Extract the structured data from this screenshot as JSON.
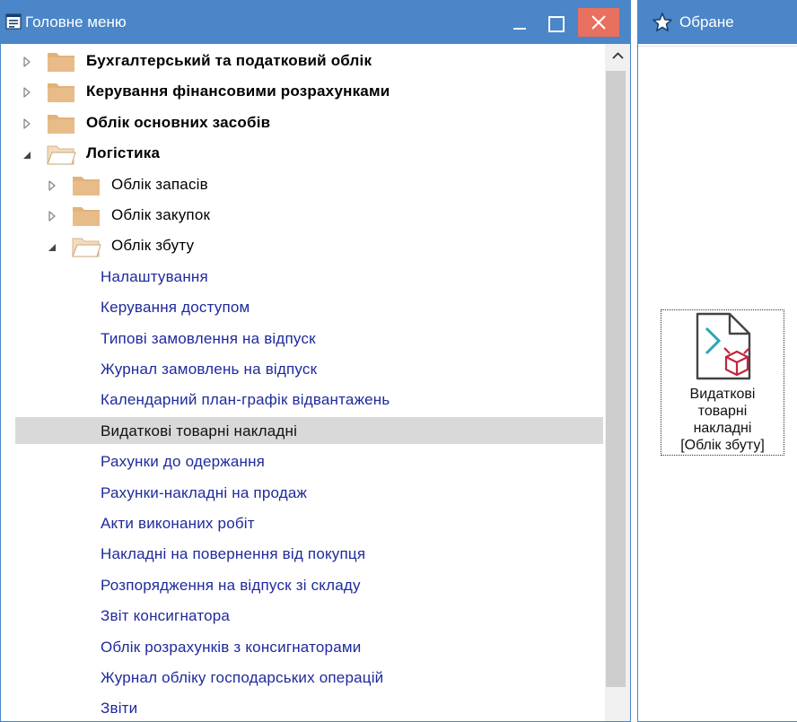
{
  "main_window": {
    "title": "Головне меню",
    "buttons": {
      "minimize": "minimize",
      "maximize": "maximize",
      "close": "close"
    }
  },
  "tree": [
    {
      "label": "Бухгалтерський та податковий облік",
      "level": 0,
      "expanded": false
    },
    {
      "label": "Керування фінансовими розрахунками",
      "level": 0,
      "expanded": false
    },
    {
      "label": "Облік основних засобів",
      "level": 0,
      "expanded": false
    },
    {
      "label": "Логістика",
      "level": 0,
      "expanded": true
    },
    {
      "label": "Облік запасів",
      "level": 1,
      "expanded": false
    },
    {
      "label": "Облік закупок",
      "level": 1,
      "expanded": false
    },
    {
      "label": "Облік збуту",
      "level": 1,
      "expanded": true
    },
    {
      "label": "Налаштування",
      "level": 2
    },
    {
      "label": "Керування доступом",
      "level": 2
    },
    {
      "label": "Типові замовлення на відпуск",
      "level": 2
    },
    {
      "label": "Журнал замовлень на відпуск",
      "level": 2
    },
    {
      "label": "Календарний план-графік відвантажень",
      "level": 2
    },
    {
      "label": "Видаткові товарні накладні",
      "level": 2,
      "selected": true
    },
    {
      "label": "Рахунки до одержання",
      "level": 2
    },
    {
      "label": "Рахунки-накладні на продаж",
      "level": 2
    },
    {
      "label": "Акти виконаних робіт",
      "level": 2
    },
    {
      "label": "Накладні на повернення від покупця",
      "level": 2
    },
    {
      "label": "Розпорядження на відпуск зі складу",
      "level": 2
    },
    {
      "label": "Звіт консигнатора",
      "level": 2
    },
    {
      "label": "Облік розрахунків з консигнаторами",
      "level": 2
    },
    {
      "label": "Журнал обліку господарських операцій",
      "level": 2
    },
    {
      "label": "Звіти",
      "level": 2
    }
  ],
  "favorites_window": {
    "title": "Обране",
    "tile": {
      "lines": [
        "Видаткові",
        "товарні",
        "накладні",
        "[Облік збуту]"
      ]
    }
  },
  "colors": {
    "titlebar": "#4a86c8",
    "close_button": "#e8705e",
    "link": "#1f2a9c",
    "selection": "#d9d9d9",
    "folder": "#e2b27a"
  }
}
